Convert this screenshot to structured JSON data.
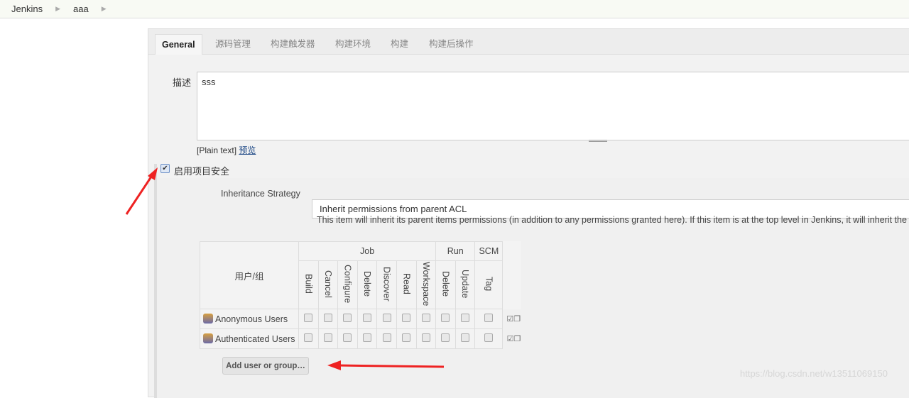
{
  "breadcrumb": [
    "Jenkins",
    "aaa"
  ],
  "tabs": [
    "General",
    "源码管理",
    "构建触发器",
    "构建环境",
    "构建",
    "构建后操作"
  ],
  "description": {
    "label": "描述",
    "value": "sss",
    "format": "[Plain text]",
    "preview": "预览"
  },
  "security": {
    "label": "启用项目安全",
    "checked": true,
    "strategy_label": "Inheritance Strategy",
    "strategy_value": "Inherit permissions from parent ACL",
    "help": "This item will inherit its parent items permissions (in addition to any permissions granted here). If this item is at the top level in Jenkins, it will inherit the g"
  },
  "matrix": {
    "user_header": "用户/组",
    "groups": [
      {
        "name": "Job",
        "cols": [
          "Build",
          "Cancel",
          "Configure",
          "Delete",
          "Discover",
          "Read",
          "Workspace"
        ]
      },
      {
        "name": "Run",
        "cols": [
          "Delete",
          "Update"
        ]
      },
      {
        "name": "SCM",
        "cols": [
          "Tag"
        ]
      }
    ],
    "rows": [
      "Anonymous Users",
      "Authenticated Users"
    ]
  },
  "add_button": "Add user or group…",
  "watermark": "https://blog.csdn.net/w13511069150",
  "colors": {
    "arrow": "#ee2222",
    "panel": "#f2f2f2"
  }
}
